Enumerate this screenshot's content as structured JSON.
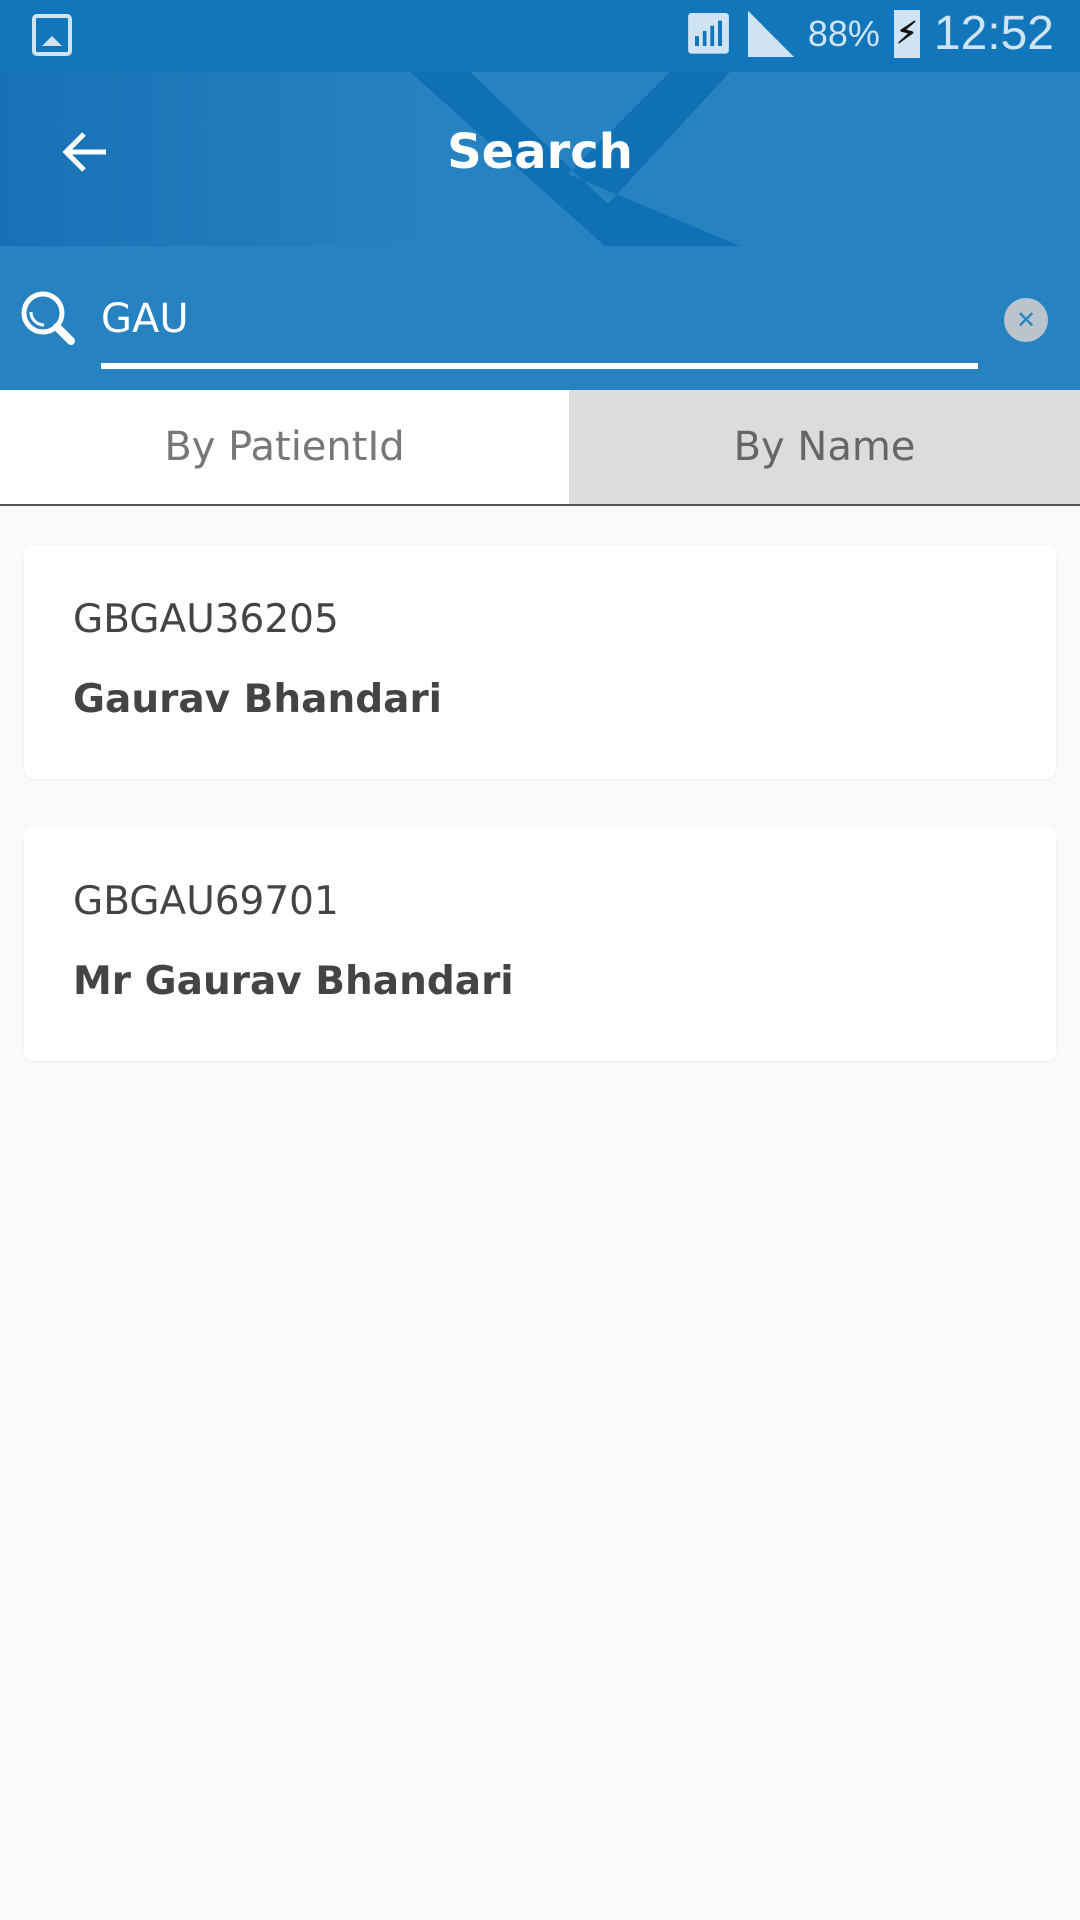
{
  "status_bar": {
    "battery": "88%",
    "time": "12:52",
    "icons": [
      "gallery-icon",
      "wifi-icon",
      "signal-icon",
      "battery-charging-icon"
    ]
  },
  "toolbar": {
    "title": "Search",
    "back_icon": "arrow-left-icon"
  },
  "search": {
    "value": "GAU",
    "search_icon": "search-icon",
    "clear_icon": "close-icon"
  },
  "tabs": [
    {
      "label": "By PatientId",
      "selected": false
    },
    {
      "label": "By Name",
      "selected": true
    }
  ],
  "results": [
    {
      "id": "GBGAU36205",
      "name": "Gaurav Bhandari"
    },
    {
      "id": "GBGAU69701",
      "name": "Mr Gaurav Bhandari"
    }
  ],
  "colors": {
    "primary": "#1276bb",
    "search_bg": "#2782c2",
    "tab_selected": "#dcdcdc"
  }
}
